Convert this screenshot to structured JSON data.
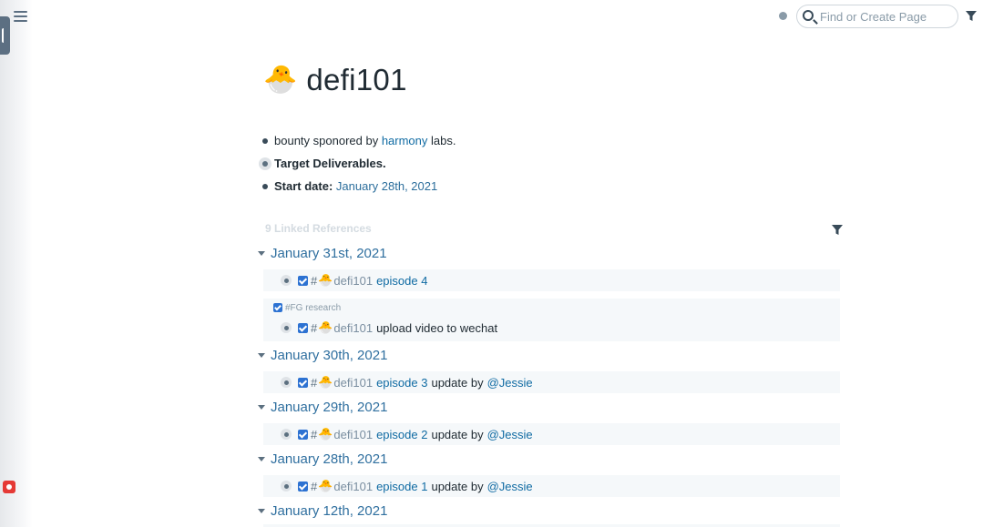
{
  "topbar": {
    "search_placeholder": "Find or Create Page",
    "menu_icon": "hamburger-menu-icon",
    "filter_icon": "filter-icon"
  },
  "page": {
    "title_emoji": "🐣",
    "title": "defi101"
  },
  "blocks": [
    {
      "pre": "bounty sponored by ",
      "link": "harmony",
      "post": " labs."
    },
    {
      "bold": "Target Deliverables."
    },
    {
      "bold": "Start date:",
      "link": "January 28th, 2021"
    }
  ],
  "linked_references": {
    "header": "9 Linked References",
    "groups": [
      {
        "date": "January 31st, 2021",
        "items": [
          {
            "hash": "#",
            "emoji": "🐣",
            "tag": "defi101",
            "link": "episode 4",
            "text": "",
            "mention": ""
          }
        ]
      },
      {
        "date": "",
        "breadcrumb": "#FG research",
        "items": [
          {
            "hash": "#",
            "emoji": "🐣",
            "tag": "defi101",
            "link": "",
            "text": "upload video to wechat",
            "mention": ""
          }
        ]
      },
      {
        "date": "January 30th, 2021",
        "items": [
          {
            "hash": "#",
            "emoji": "🐣",
            "tag": "defi101",
            "link": "episode 3",
            "text": "update by",
            "mention": "@Jessie"
          }
        ]
      },
      {
        "date": "January 29th, 2021",
        "items": [
          {
            "hash": "#",
            "emoji": "🐣",
            "tag": "defi101",
            "link": "episode 2",
            "text": "update by",
            "mention": "@Jessie"
          }
        ]
      },
      {
        "date": "January 28th, 2021",
        "items": [
          {
            "hash": "#",
            "emoji": "🐣",
            "tag": "defi101",
            "link": "episode 1",
            "text": "update by",
            "mention": "@Jessie"
          }
        ]
      },
      {
        "date": "January 12th, 2021",
        "items": []
      }
    ]
  },
  "colors": {
    "link": "#106ba3",
    "checkbox": "#2d72d2",
    "reference_bg": "#f5f8fa",
    "sidebar_red": "#e53935"
  }
}
